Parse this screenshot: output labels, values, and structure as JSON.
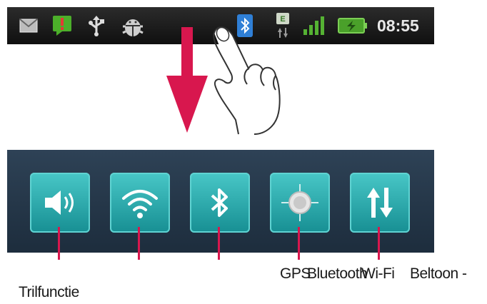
{
  "status_bar": {
    "icons": [
      "mail-icon",
      "alert-icon",
      "usb-icon",
      "android-debug-icon",
      "bluetooth-icon",
      "data-transfer-icon",
      "signal-icon",
      "battery-icon"
    ],
    "clock": "08:55"
  },
  "quick_settings": {
    "buttons": [
      {
        "name": "sound-toggle",
        "icon": "speaker-icon"
      },
      {
        "name": "wifi-toggle",
        "icon": "wifi-icon"
      },
      {
        "name": "bluetooth-toggle",
        "icon": "bluetooth-icon"
      },
      {
        "name": "gps-toggle",
        "icon": "gps-icon"
      },
      {
        "name": "mobile-data-toggle",
        "icon": "data-arrows-icon"
      }
    ]
  },
  "labels": {
    "vibrate": "Trilfunctie",
    "gps": "GPS",
    "bluetooth": "Bluetooth",
    "wifi": "Wi-Fi",
    "data": "Beltoon -"
  },
  "colors": {
    "accent": "#d8174e",
    "button": "#2aaeb0",
    "panel": "#24364a"
  }
}
